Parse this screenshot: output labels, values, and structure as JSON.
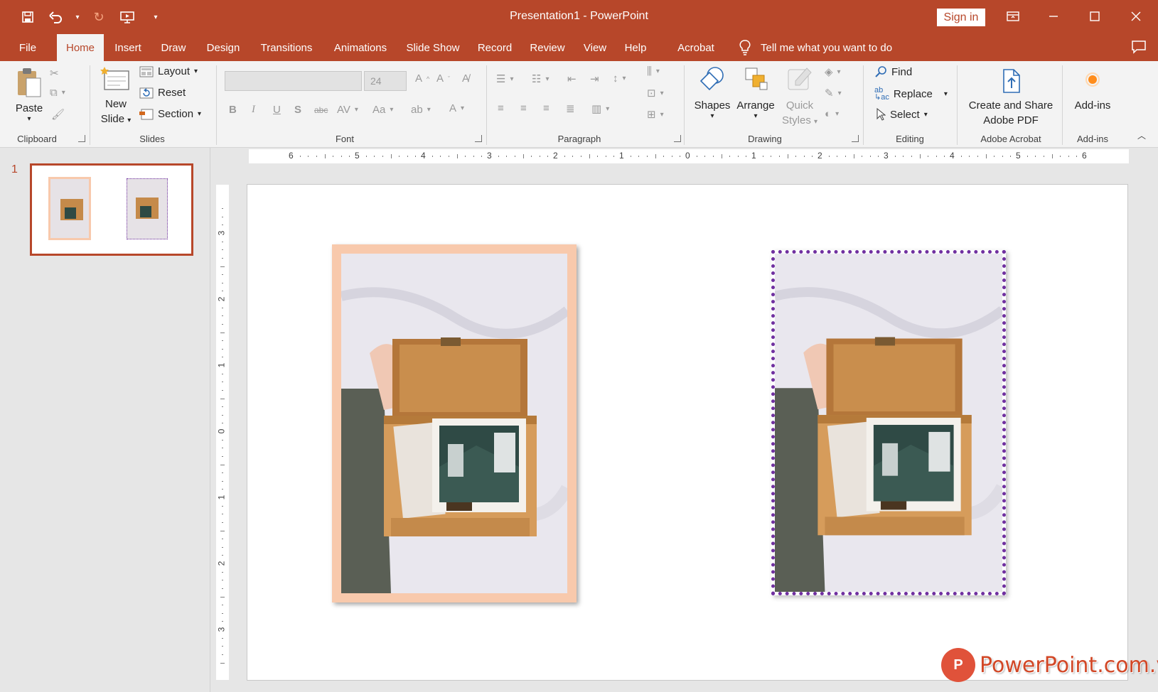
{
  "window": {
    "title": "Presentation1  -  PowerPoint",
    "sign_in": "Sign in"
  },
  "tabs": [
    "File",
    "Home",
    "Insert",
    "Draw",
    "Design",
    "Transitions",
    "Animations",
    "Slide Show",
    "Record",
    "Review",
    "View",
    "Help",
    "Acrobat"
  ],
  "active_tab": "Home",
  "tell_me": "Tell me what you want to do",
  "ribbon": {
    "clipboard": {
      "label": "Clipboard",
      "paste": "Paste"
    },
    "slides": {
      "label": "Slides",
      "new_slide_1": "New",
      "new_slide_2": "Slide",
      "layout": "Layout",
      "reset": "Reset",
      "section": "Section"
    },
    "font": {
      "label": "Font",
      "size": "24"
    },
    "paragraph": {
      "label": "Paragraph"
    },
    "drawing": {
      "label": "Drawing",
      "shapes": "Shapes",
      "arrange": "Arrange",
      "quick_1": "Quick",
      "quick_2": "Styles"
    },
    "editing": {
      "label": "Editing",
      "find": "Find",
      "replace": "Replace",
      "select": "Select"
    },
    "acrobat": {
      "label": "Adobe Acrobat",
      "create_1": "Create and Share",
      "create_2": "Adobe PDF"
    },
    "addins": {
      "label": "Add-ins",
      "button": "Add-ins"
    }
  },
  "thumbnail": {
    "slide_number": "1"
  },
  "ruler": {
    "h_numbers": [
      "6",
      "5",
      "4",
      "3",
      "2",
      "1",
      "0",
      "1",
      "2",
      "3",
      "4",
      "5",
      "6"
    ],
    "v_numbers": [
      "3",
      "2",
      "1",
      "0",
      "1",
      "2",
      "3"
    ]
  },
  "colors": {
    "accent": "#b7472a",
    "frame_peach": "#f8c9ac",
    "frame_purple_dotted": "#7030a0"
  },
  "watermark": {
    "logo": "P",
    "text": "PowerPoint.com.vn"
  }
}
